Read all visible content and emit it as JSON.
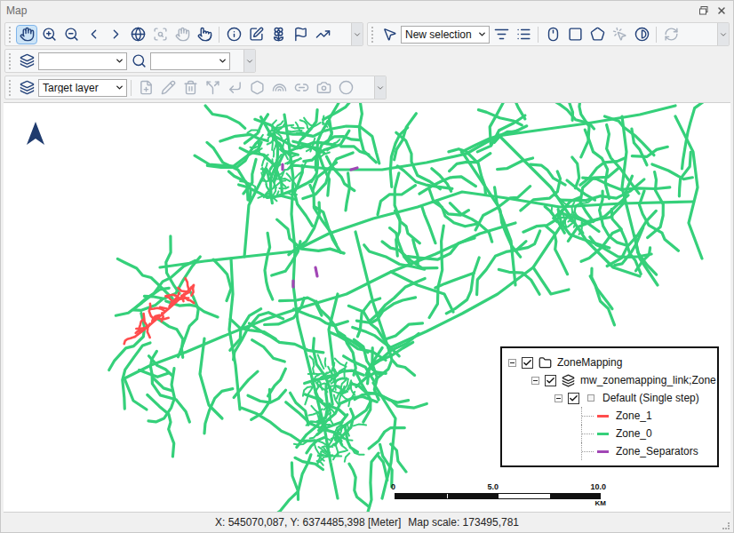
{
  "window": {
    "title": "Map"
  },
  "tools": {
    "pan_selected": true
  },
  "selection_mode": "New selection",
  "target_layer": "Target layer",
  "legend": {
    "root": {
      "label": "ZoneMapping",
      "checked": true,
      "expanded": true
    },
    "layer": {
      "label": "mw_zonemapping_link;Zone",
      "checked": true,
      "expanded": true
    },
    "style": {
      "label": "Default (Single step)",
      "checked": true,
      "expanded": true
    },
    "items": [
      {
        "label": "Zone_1",
        "color": "#ff4d4d"
      },
      {
        "label": "Zone_0",
        "color": "#35d07a"
      },
      {
        "label": "Zone_Separators",
        "color": "#a146b5"
      }
    ]
  },
  "scale_bar": {
    "ticks": [
      "0",
      "5.0",
      "10.0"
    ],
    "unit": "KM"
  },
  "status_bar": {
    "coordinates": "X: 545070,087, Y: 6374485,398 [Meter]",
    "map_scale": "Map scale: 173495,781"
  }
}
